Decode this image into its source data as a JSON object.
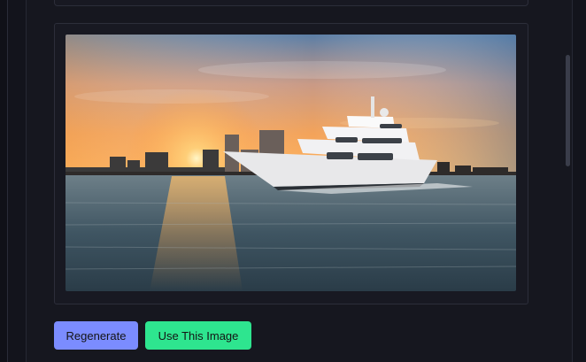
{
  "image": {
    "alt": "Luxury yacht cruising at sunset with city skyline"
  },
  "actions": {
    "regenerate_label": "Regenerate",
    "use_image_label": "Use This Image"
  },
  "colors": {
    "background": "#13141c",
    "card_border": "#2c2e3a",
    "regenerate_button": "#7b8cff",
    "use_button": "#2ee58f"
  }
}
